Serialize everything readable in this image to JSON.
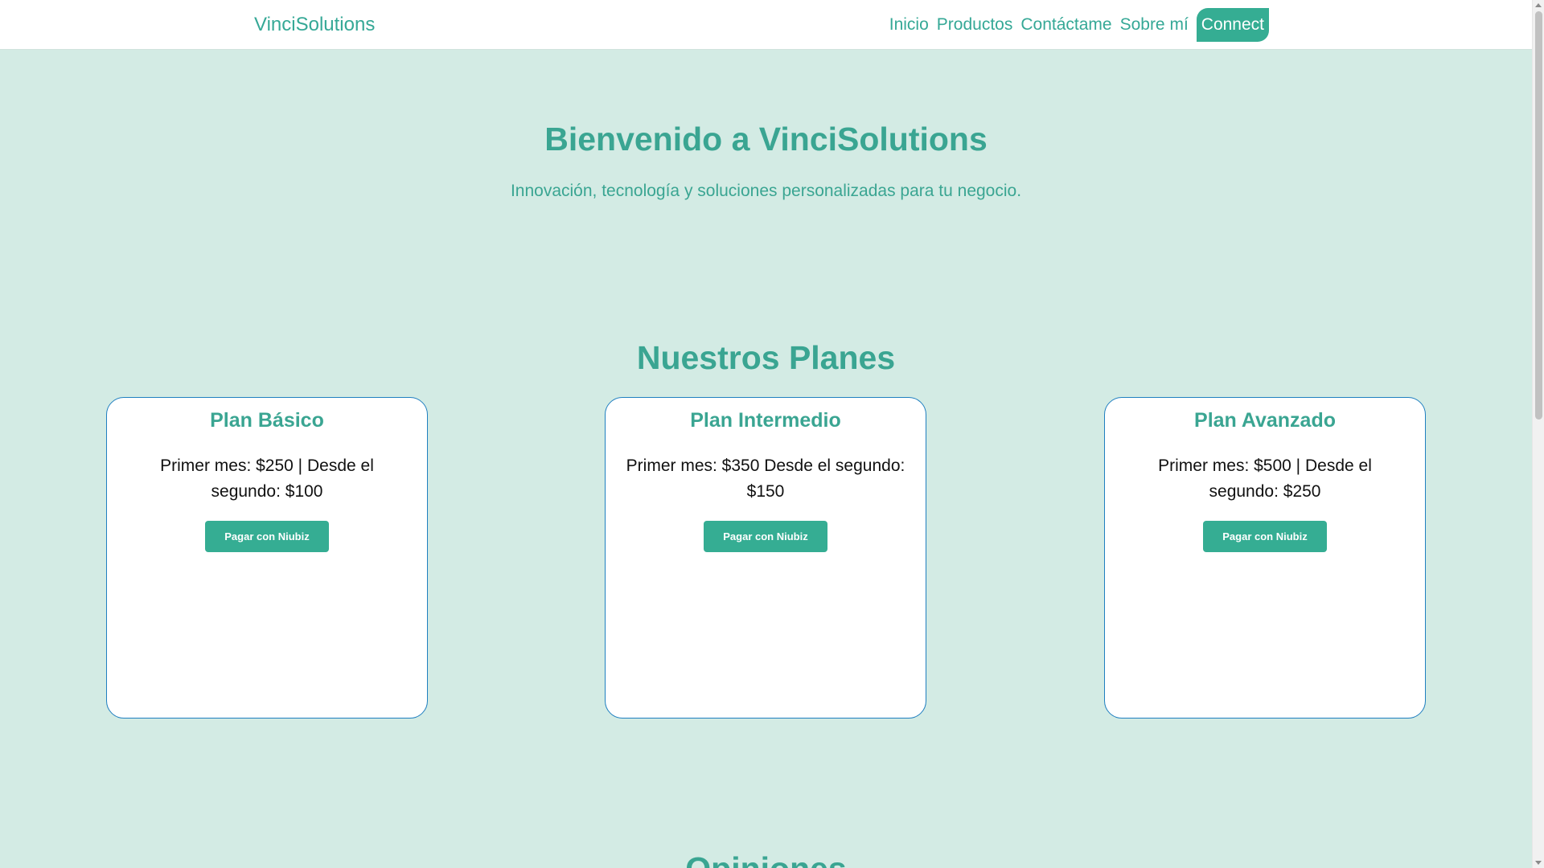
{
  "navbar": {
    "brand": "VinciSolutions",
    "links": [
      "Inicio",
      "Productos",
      "Contáctame",
      "Sobre mí"
    ],
    "connect_label": "Connect"
  },
  "hero": {
    "title": "Bienvenido a VinciSolutions",
    "subtitle": "Innovación, tecnología y soluciones personalizadas para tu negocio."
  },
  "plans": {
    "title": "Nuestros Planes",
    "items": [
      {
        "name": "Plan Básico",
        "price": "Primer mes: $250 | Desde el segundo: $100",
        "button": "Pagar con Niubiz"
      },
      {
        "name": "Plan Intermedio",
        "price": "Primer mes: $350 Desde el segundo: $150",
        "button": "Pagar con Niubiz"
      },
      {
        "name": "Plan Avanzado",
        "price": "Primer mes: $500 | Desde el segundo: $250",
        "button": "Pagar con Niubiz"
      }
    ]
  },
  "opinions": {
    "title": "Opiniones"
  },
  "colors": {
    "accent": "#35ad93",
    "background": "#d3ebe4",
    "card_border": "#1f7fc0"
  }
}
